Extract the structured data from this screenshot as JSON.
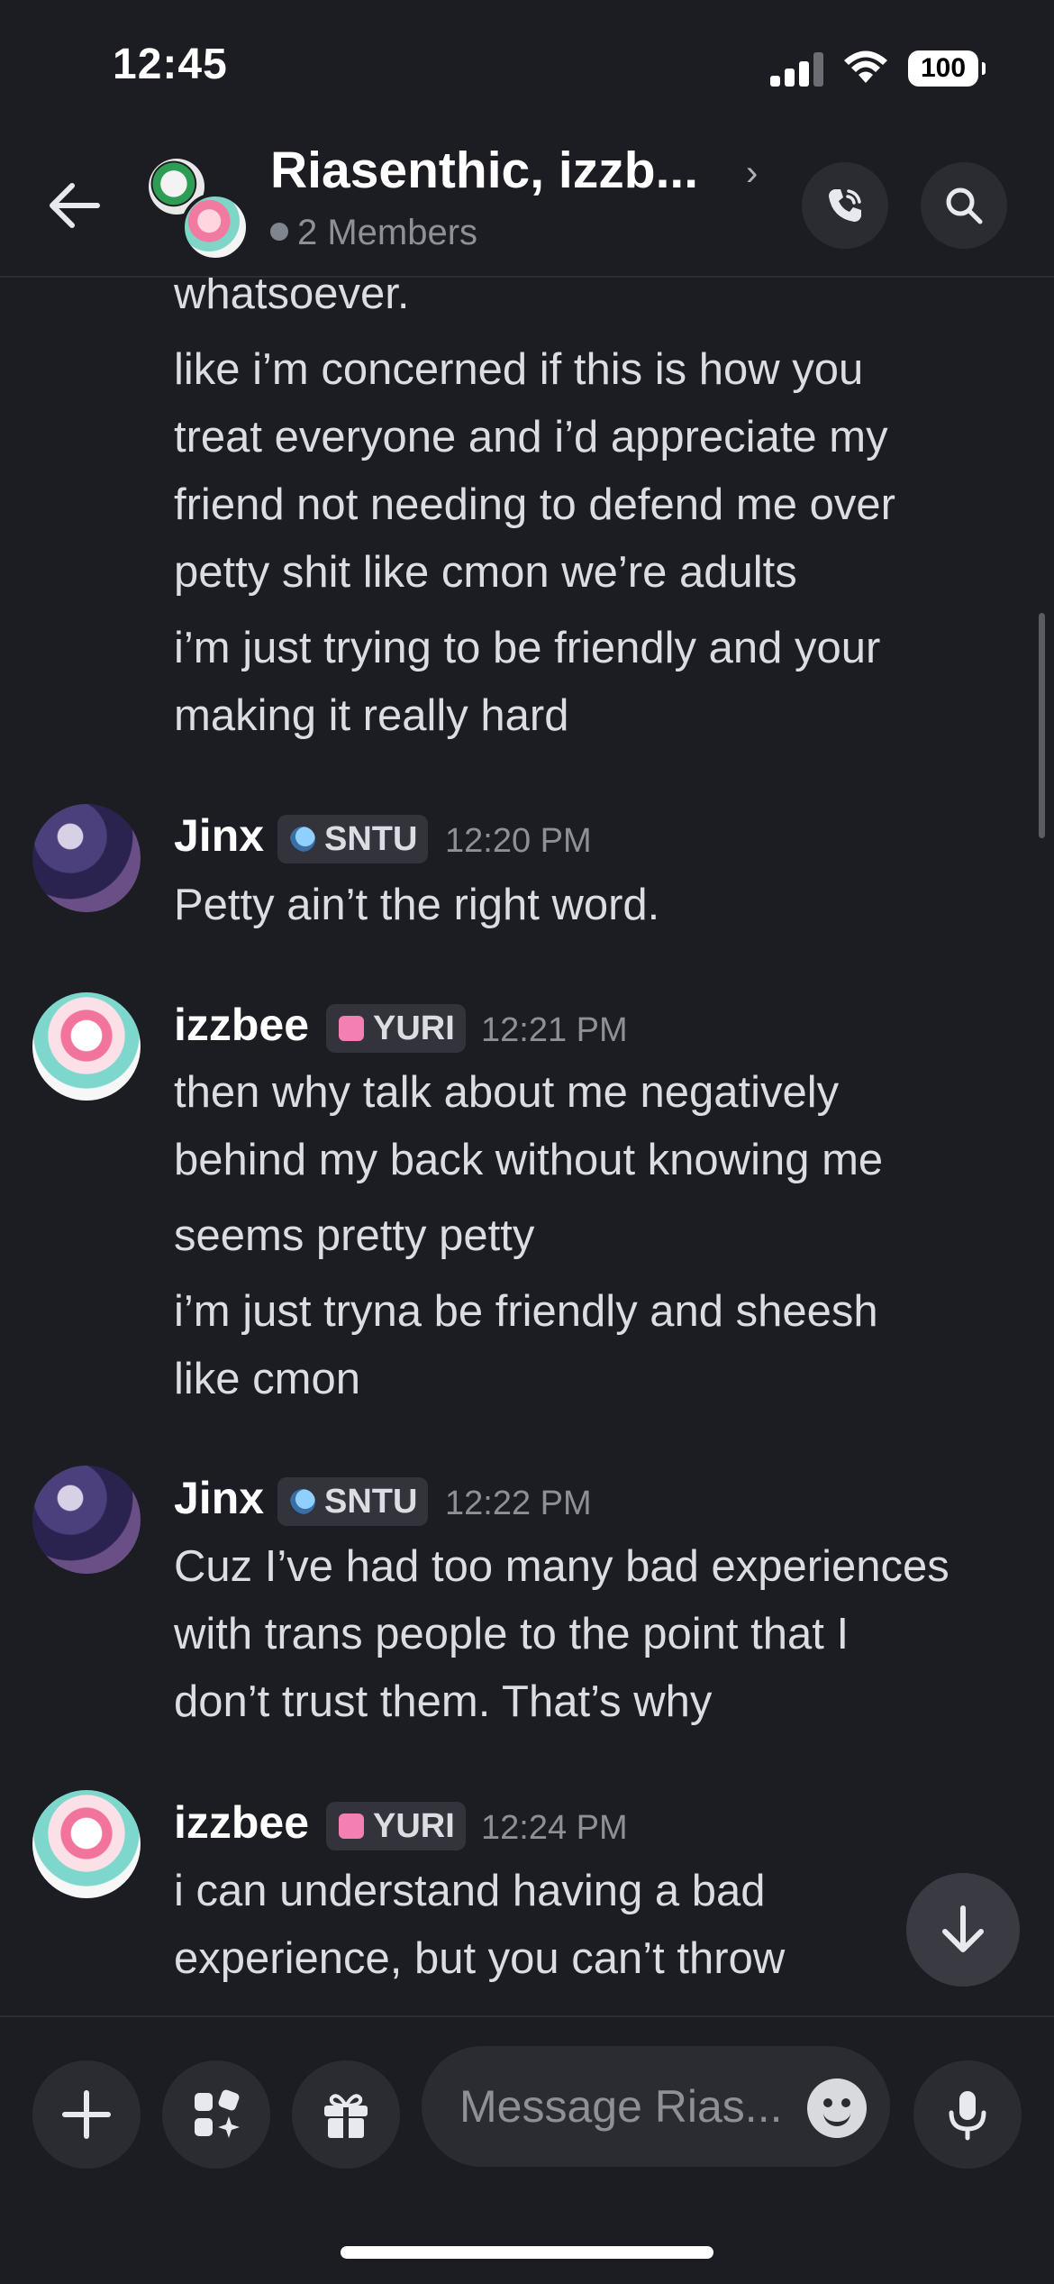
{
  "status_bar": {
    "time": "12:45",
    "battery": "100"
  },
  "header": {
    "title": "Riasenthic, izzb...",
    "members": "2 Members",
    "icons": [
      "back-arrow-icon",
      "call-icon",
      "search-icon"
    ]
  },
  "messages": {
    "continued": [
      "whatsoever.",
      "like i’m concerned if this is how you",
      "treat everyone and i’d appreciate my",
      "friend not needing to defend me over",
      "petty shit like cmon we’re adults",
      "i’m just trying to be friendly and your",
      "making it really hard"
    ],
    "groups": [
      {
        "author": "Jinx",
        "tag": "SNTU",
        "time": "12:20 PM",
        "lines": [
          "Petty ain’t the right word."
        ]
      },
      {
        "author": "izzbee",
        "tag": "YURI",
        "time": "12:21 PM",
        "lines": [
          "then why talk about me negatively",
          "behind my back without knowing me",
          "seems pretty petty",
          "i’m just tryna be friendly and sheesh",
          "like cmon"
        ]
      },
      {
        "author": "Jinx",
        "tag": "SNTU",
        "time": "12:22 PM",
        "lines": [
          "Cuz I’ve had too many bad experiences",
          "with trans people to the point that I",
          "don’t trust them. That’s why"
        ]
      },
      {
        "author": "izzbee",
        "tag": "YURI",
        "time": "12:24 PM",
        "lines": [
          "i can understand having a bad",
          "experience, but you can’t throw"
        ]
      }
    ]
  },
  "composer": {
    "placeholder": "Message Rias...",
    "icons": [
      "plus-icon",
      "apps-icon",
      "gift-icon",
      "emoji-icon",
      "microphone-icon"
    ]
  }
}
